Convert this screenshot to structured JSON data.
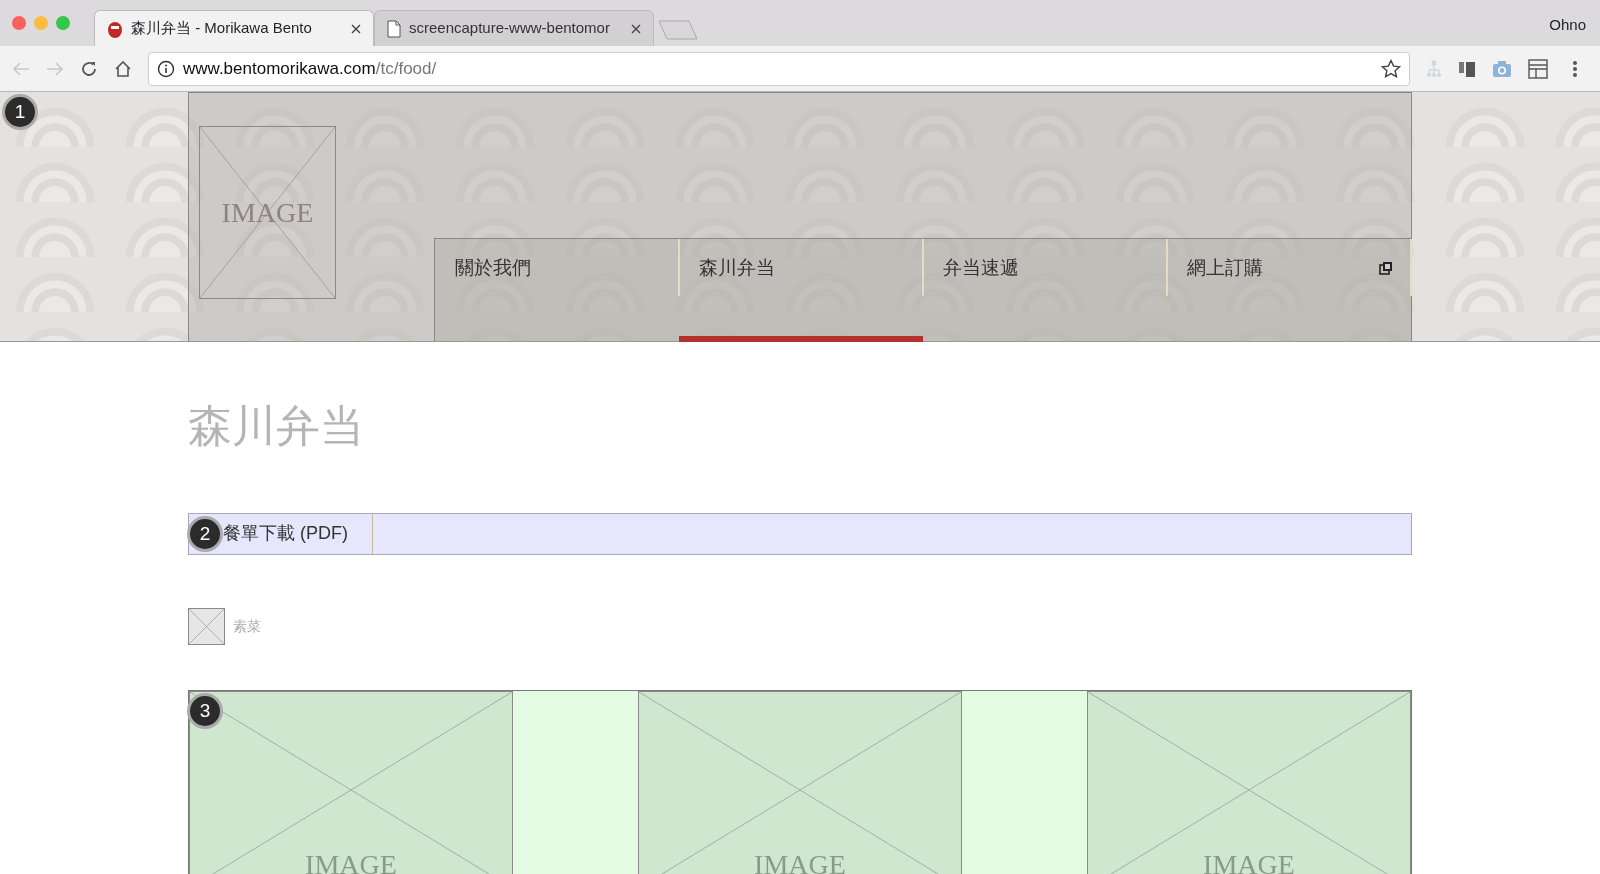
{
  "browser": {
    "tabs": [
      {
        "title": "森川弁当 - Morikawa Bento",
        "selected": true,
        "kind": "site"
      },
      {
        "title": "screencapture-www-bentomor",
        "selected": false,
        "kind": "file"
      }
    ],
    "profile": "Ohno",
    "url": {
      "host": "www.bentomorikawa.com",
      "path": "/tc/food/"
    }
  },
  "header": {
    "marker": "1",
    "logo_placeholder": "IMAGE",
    "nav": [
      {
        "label": "關於我們",
        "selected": false,
        "external": false
      },
      {
        "label": "森川弁当",
        "selected": true,
        "external": false
      },
      {
        "label": "弁当速遞",
        "selected": false,
        "external": false
      },
      {
        "label": "網上訂購",
        "selected": false,
        "external": true
      }
    ]
  },
  "page_title": "森川弁当",
  "download_bar": {
    "marker": "2",
    "label": "餐單下載 (PDF)"
  },
  "category": {
    "label": "素菜"
  },
  "gallery": {
    "marker": "3",
    "items": [
      {
        "label": "IMAGE"
      },
      {
        "label": "IMAGE"
      },
      {
        "label": "IMAGE"
      }
    ]
  }
}
